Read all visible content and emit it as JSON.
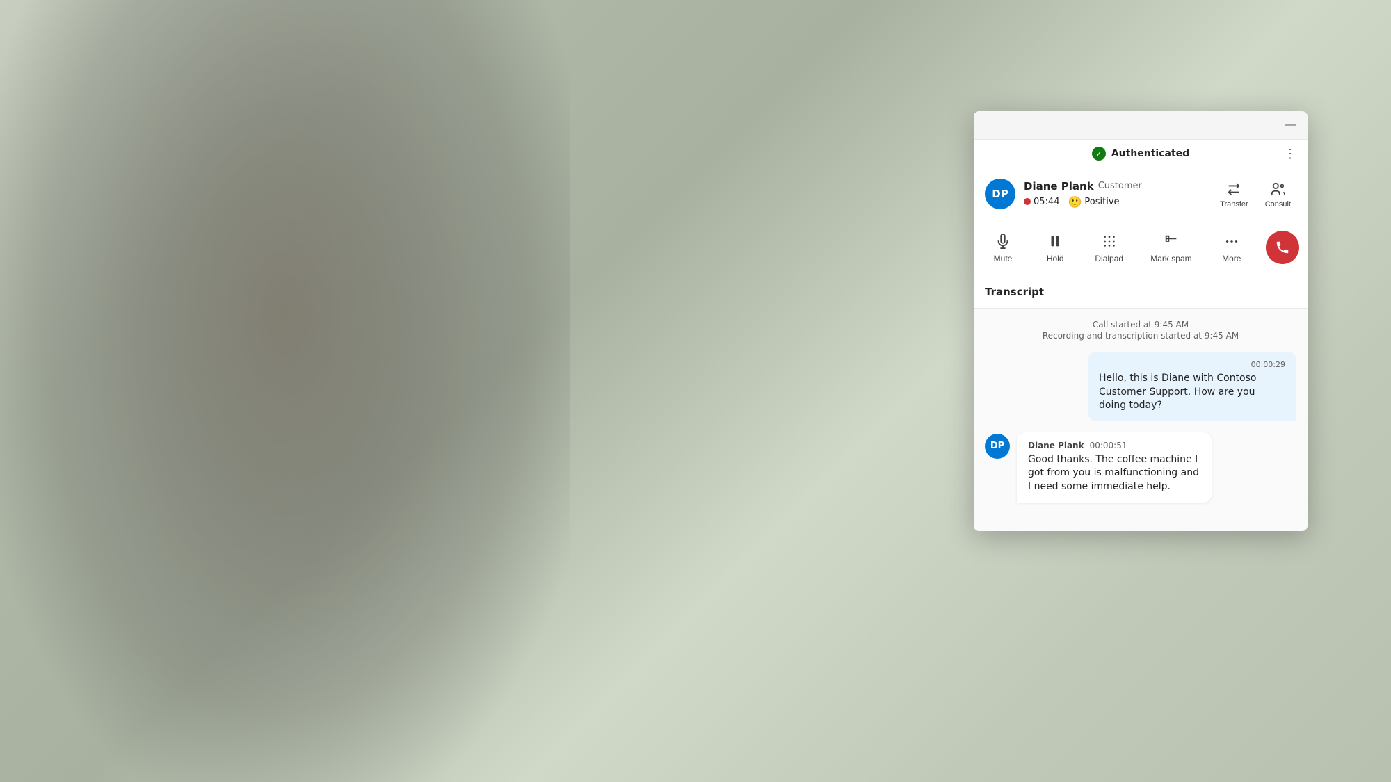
{
  "background": {
    "color": "#b8bfb0"
  },
  "panel": {
    "minimize_label": "—",
    "auth_status": "Authenticated",
    "auth_menu_dots": "⋮",
    "contact": {
      "initials": "DP",
      "name": "Diane Plank",
      "role": "Customer",
      "call_duration": "05:44",
      "sentiment_label": "Positive",
      "sentiment_emoji": "🙂"
    },
    "action_buttons": [
      {
        "id": "transfer",
        "label": "Transfer"
      },
      {
        "id": "consult",
        "label": "Consult"
      }
    ],
    "call_controls": [
      {
        "id": "mute",
        "label": "Mute"
      },
      {
        "id": "hold",
        "label": "Hold"
      },
      {
        "id": "dialpad",
        "label": "Dialpad"
      },
      {
        "id": "mark-spam",
        "label": "Mark spam"
      },
      {
        "id": "more",
        "label": "More"
      }
    ],
    "end_call_label": "End call",
    "transcript": {
      "title": "Transcript",
      "call_started": "Call started at 9:45 AM",
      "recording_started": "Recording and transcription started at 9:45 AM",
      "messages": [
        {
          "id": "msg-1",
          "sender": "agent",
          "timestamp": "00:00:29",
          "text": "Hello, this is Diane with Contoso Customer Support. How are you doing today?"
        },
        {
          "id": "msg-2",
          "sender": "customer",
          "name": "Diane Plank",
          "initials": "DP",
          "timestamp": "00:00:51",
          "text": "Good thanks. The coffee machine I got from you is malfunctioning and I need some immediate help."
        }
      ]
    }
  }
}
